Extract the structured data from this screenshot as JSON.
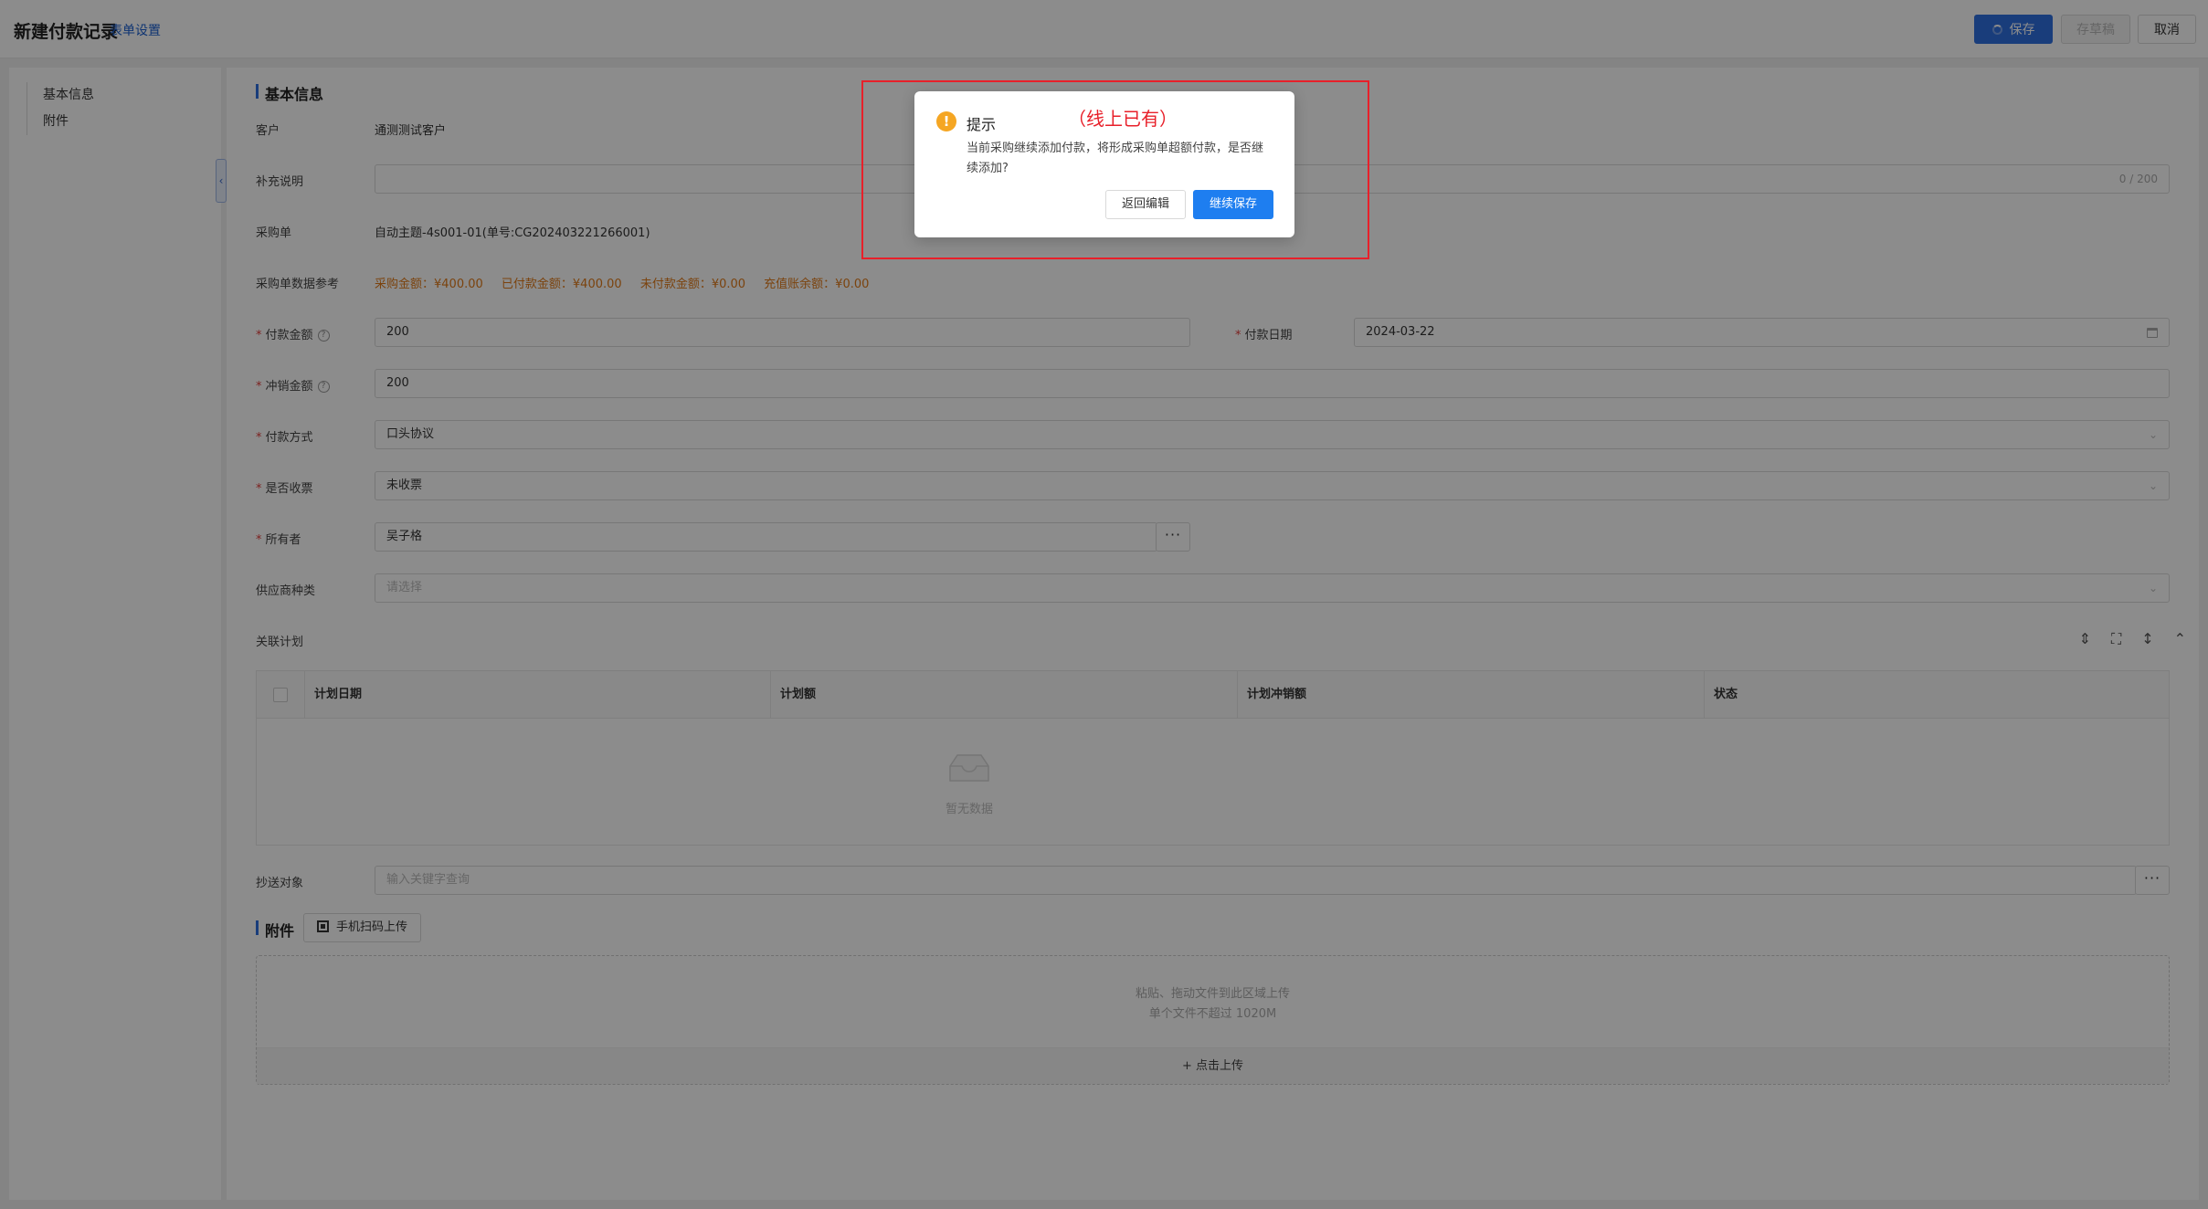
{
  "header": {
    "title": "新建付款记录",
    "form_settings": "表单设置",
    "save_label": "保存",
    "draft_label": "存草稿",
    "cancel_label": "取消",
    "primary_color": "#2f6fe0"
  },
  "sidebar": {
    "items": [
      {
        "label": "基本信息"
      },
      {
        "label": "附件"
      }
    ],
    "collapse_icon": "chevron-left-icon"
  },
  "basic_info": {
    "section_title": "基本信息",
    "customer": {
      "label": "客户",
      "value": "通测测试客户"
    },
    "supplement": {
      "label": "补充说明",
      "value": "",
      "counter": "0 / 200"
    },
    "purchase_order": {
      "label": "采购单",
      "value": "自动主题-4s001-01(单号:CG202403221266001)"
    },
    "po_reference": {
      "label": "采购单数据参考",
      "items": [
        "采购金额：¥400.00",
        "已付款金额：¥400.00",
        "未付款金额：¥0.00",
        "充值账余额：¥0.00"
      ],
      "color": "#e07b1a"
    },
    "payment_amount": {
      "label": "付款金额",
      "value": "200",
      "required": "*"
    },
    "payment_date": {
      "label": "付款日期",
      "value": "2024-03-22",
      "required": "*"
    },
    "writeoff_amount": {
      "label": "冲销金额",
      "value": "200",
      "required": "*"
    },
    "payment_method": {
      "label": "付款方式",
      "value": "口头协议",
      "required": "*"
    },
    "invoice_received": {
      "label": "是否收票",
      "value": "未收票",
      "required": "*"
    },
    "owner": {
      "label": "所有者",
      "value": "吴子格",
      "required": "*",
      "more": "···"
    },
    "supplier_type": {
      "label": "供应商种类",
      "placeholder": "请选择"
    },
    "related_plan": {
      "label": "关联计划",
      "columns": [
        "计划日期",
        "计划额",
        "计划冲销额",
        "状态"
      ],
      "empty_text": "暂无数据",
      "tool_icons": [
        "row-height-icon",
        "fullscreen-icon",
        "column-settings-icon",
        "chevron-up-icon"
      ]
    },
    "cc": {
      "label": "抄送对象",
      "placeholder": "输入关键字查询",
      "more": "···"
    }
  },
  "attachment": {
    "section_title": "附件",
    "qr_button": "手机扫码上传",
    "hint_line1": "粘贴、拖动文件到此区域上传",
    "hint_line2": "单个文件不超过 1020M",
    "upload_button": "+ 点击上传"
  },
  "dialog": {
    "icon": "!",
    "title": "提示",
    "message": "当前采购继续添加付款，将形成采购单超额付款，是否继续添加?",
    "back_label": "返回编辑",
    "continue_label": "继续保存",
    "annotation": "（线上已有）",
    "annotation_color": "#e8202a"
  }
}
